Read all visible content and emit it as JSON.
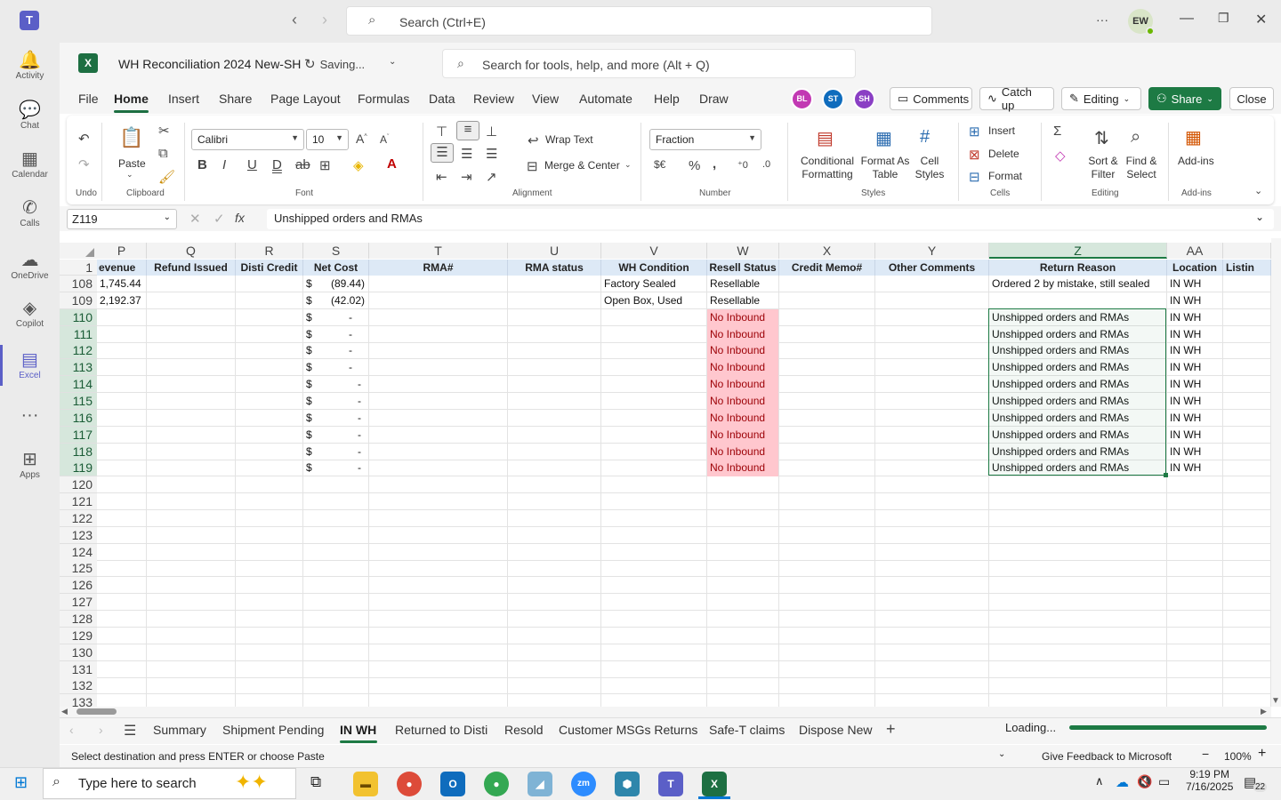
{
  "teams": {
    "search_placeholder": "Search (Ctrl+E)",
    "user_initials": "EW",
    "more": "···",
    "rail": [
      {
        "label": "Activity",
        "icon": "bell-icon",
        "glyph": "🔔"
      },
      {
        "label": "Chat",
        "icon": "chat-icon",
        "glyph": "💬"
      },
      {
        "label": "Calendar",
        "icon": "calendar-icon",
        "glyph": "▦"
      },
      {
        "label": "Calls",
        "icon": "phone-icon",
        "glyph": "✆"
      },
      {
        "label": "OneDrive",
        "icon": "cloud-icon",
        "glyph": "☁"
      },
      {
        "label": "Copilot",
        "icon": "copilot-icon",
        "glyph": "◈"
      },
      {
        "label": "Excel",
        "icon": "excel-icon",
        "glyph": "▤"
      },
      {
        "label": "",
        "icon": "more-icon",
        "glyph": "···"
      },
      {
        "label": "Apps",
        "icon": "apps-icon",
        "glyph": "⊞"
      }
    ]
  },
  "excel": {
    "doc_title": "WH Reconciliation 2024 New-SH",
    "saving": "Saving...",
    "search_placeholder": "Search for tools, help, and more (Alt + Q)",
    "menu": [
      "File",
      "Home",
      "Insert",
      "Share",
      "Page Layout",
      "Formulas",
      "Data",
      "Review",
      "View",
      "Automate",
      "Help",
      "Draw"
    ],
    "presence": [
      {
        "initials": "BL",
        "color": "#c239b3"
      },
      {
        "initials": "ST",
        "color": "#0f6cbd"
      },
      {
        "initials": "SH",
        "color": "#8a3fc4"
      }
    ],
    "comments": "Comments",
    "catchup": "Catch up",
    "editing": "Editing",
    "share": "Share",
    "close": "Close",
    "ribbon": {
      "undo": "Undo",
      "clipboard": "Clipboard",
      "paste": "Paste",
      "font_name": "Calibri",
      "font_size": "10",
      "font": "Font",
      "alignment": "Alignment",
      "wrap_text": "Wrap Text",
      "merge_center": "Merge & Center",
      "number_format": "Fraction",
      "number": "Number",
      "conditional_formatting": [
        "Conditional",
        "Formatting"
      ],
      "format_as_table": [
        "Format As",
        "Table"
      ],
      "cell_styles": [
        "Cell",
        "Styles"
      ],
      "styles": "Styles",
      "insert": "Insert",
      "delete": "Delete",
      "format": "Format",
      "cells": "Cells",
      "sort_filter": [
        "Sort &",
        "Filter"
      ],
      "find_select": [
        "Find &",
        "Select"
      ],
      "editing": "Editing",
      "addins": "Add-ins",
      "addins_group": "Add-ins"
    },
    "name_box": "Z119",
    "formula": "Unshipped orders and RMAs",
    "columns": [
      "P",
      "Q",
      "R",
      "S",
      "T",
      "U",
      "V",
      "W",
      "X",
      "Y",
      "Z",
      "AA"
    ],
    "header_row": [
      "evenue",
      "Refund Issued",
      "Disti Credit",
      "Net Cost",
      "RMA#",
      "RMA status",
      "WH Condition",
      "Resell Status",
      "Credit Memo#",
      "Other Comments",
      "Return Reason",
      "Location",
      "Listin"
    ],
    "rows": [
      {
        "n": "1"
      },
      {
        "n": "108",
        "P": "1,745.44",
        "S_sym": "$",
        "S": "(89.44)",
        "V": "Factory Sealed",
        "W": "Resellable",
        "Z": "Ordered 2 by mistake, still sealed",
        "AA": "IN WH"
      },
      {
        "n": "109",
        "P": "2,192.37",
        "S_sym": "$",
        "S": "(42.02)",
        "V": "Open Box, Used",
        "W": "Resellable",
        "Z": "",
        "AA": "IN WH"
      },
      {
        "n": "110",
        "S_sym": "$",
        "S": "-",
        "W": "No Inbound",
        "Z": "Unshipped orders and RMAs",
        "AA": "IN WH"
      },
      {
        "n": "111",
        "S_sym": "$",
        "S": "-",
        "W": "No Inbound",
        "Z": "Unshipped orders and RMAs",
        "AA": "IN WH"
      },
      {
        "n": "112",
        "S_sym": "$",
        "S": "-",
        "W": "No Inbound",
        "Z": "Unshipped orders and RMAs",
        "AA": "IN WH"
      },
      {
        "n": "113",
        "S_sym": "$",
        "S": "-",
        "W": "No Inbound",
        "Z": "Unshipped orders and RMAs",
        "AA": "IN WH"
      },
      {
        "n": "114",
        "S_sym": "$",
        "S": "-",
        "W": "No Inbound",
        "Z": "Unshipped orders and RMAs",
        "AA": "IN WH"
      },
      {
        "n": "115",
        "S_sym": "$",
        "S": "-",
        "W": "No Inbound",
        "Z": "Unshipped orders and RMAs",
        "AA": "IN WH"
      },
      {
        "n": "116",
        "S_sym": "$",
        "S": "-",
        "W": "No Inbound",
        "Z": "Unshipped orders and RMAs",
        "AA": "IN WH"
      },
      {
        "n": "117",
        "S_sym": "$",
        "S": "-",
        "W": "No Inbound",
        "Z": "Unshipped orders and RMAs",
        "AA": "IN WH"
      },
      {
        "n": "118",
        "S_sym": "$",
        "S": "-",
        "W": "No Inbound",
        "Z": "Unshipped orders and RMAs",
        "AA": "IN WH"
      },
      {
        "n": "119",
        "S_sym": "$",
        "S": "-",
        "W": "No Inbound",
        "Z": "Unshipped orders and RMAs",
        "AA": "IN WH"
      },
      {
        "n": "120"
      },
      {
        "n": "121"
      },
      {
        "n": "122"
      },
      {
        "n": "123"
      },
      {
        "n": "124"
      },
      {
        "n": "125"
      },
      {
        "n": "126"
      },
      {
        "n": "127"
      },
      {
        "n": "128"
      },
      {
        "n": "129"
      },
      {
        "n": "130"
      },
      {
        "n": "131"
      },
      {
        "n": "132"
      },
      {
        "n": "133"
      }
    ],
    "sheets": [
      "Summary",
      "Shipment Pending",
      "IN WH",
      "Returned to Disti",
      "Resold",
      "Customer MSGs Returns",
      "Safe-T claims",
      "Dispose New"
    ],
    "active_sheet": "IN WH",
    "loading": "Loading...",
    "status_msg": "Select destination and press ENTER or choose Paste",
    "feedback": "Give Feedback to Microsoft",
    "zoom": "100%"
  },
  "taskbar": {
    "search_placeholder": "Type here to search",
    "time": "9:19 PM",
    "date": "7/16/2025",
    "notifications": "22"
  },
  "colors": {
    "excel_green": "#1d7a44",
    "pink_fill": "#ffc7ce",
    "pink_text": "#9c0006",
    "header_fill": "#dde9f6"
  }
}
